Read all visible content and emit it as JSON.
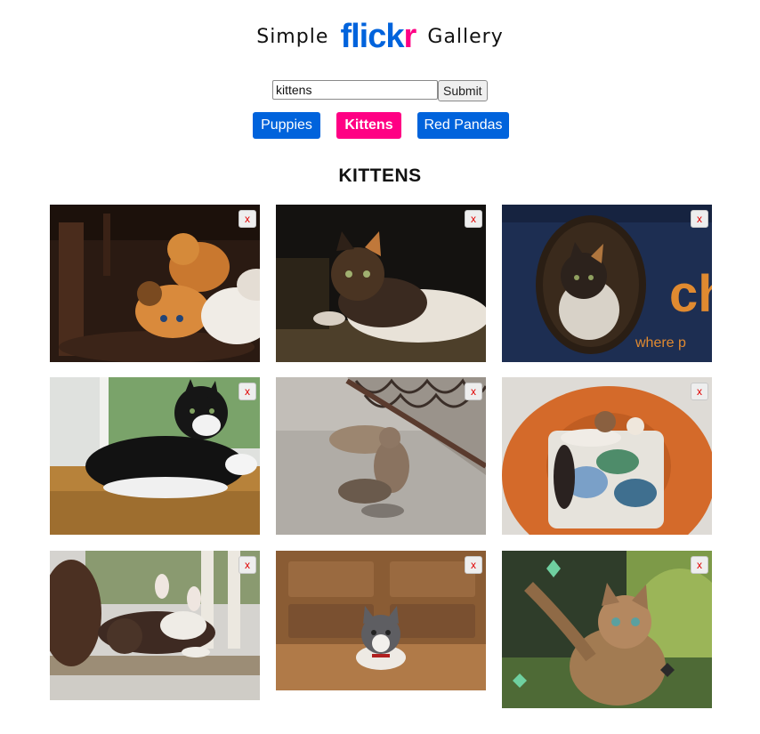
{
  "header": {
    "word_left": "Simple",
    "brand_part1": "flick",
    "brand_part2": "r",
    "word_right": "Gallery",
    "colors": {
      "brand_blue": "#0063dc",
      "brand_pink": "#ff0084"
    }
  },
  "search": {
    "value": "kittens",
    "submit_label": "Submit"
  },
  "nav": {
    "buttons": [
      {
        "label": "Puppies",
        "active": false
      },
      {
        "label": "Kittens",
        "active": true
      },
      {
        "label": "Red Pandas",
        "active": false
      }
    ]
  },
  "gallery": {
    "heading": "KITTENS",
    "close_label": "x",
    "photos": [
      {
        "subject": "orange-kittens-on-chair",
        "icon": "photo-icon"
      },
      {
        "subject": "calico-kitten-on-blanket",
        "icon": "photo-icon"
      },
      {
        "subject": "kitten-in-cardboard-box",
        "icon": "photo-icon"
      },
      {
        "subject": "black-white-kitten-on-mat",
        "icon": "photo-icon"
      },
      {
        "subject": "tabby-cats-on-pavement",
        "icon": "photo-icon"
      },
      {
        "subject": "cats-on-orange-pillow",
        "icon": "photo-icon"
      },
      {
        "subject": "kitten-rolling-on-floor",
        "icon": "photo-icon"
      },
      {
        "subject": "gray-white-kitten-on-wood",
        "icon": "photo-icon"
      },
      {
        "subject": "tabby-kitten-with-butterflies",
        "icon": "photo-icon"
      }
    ]
  }
}
